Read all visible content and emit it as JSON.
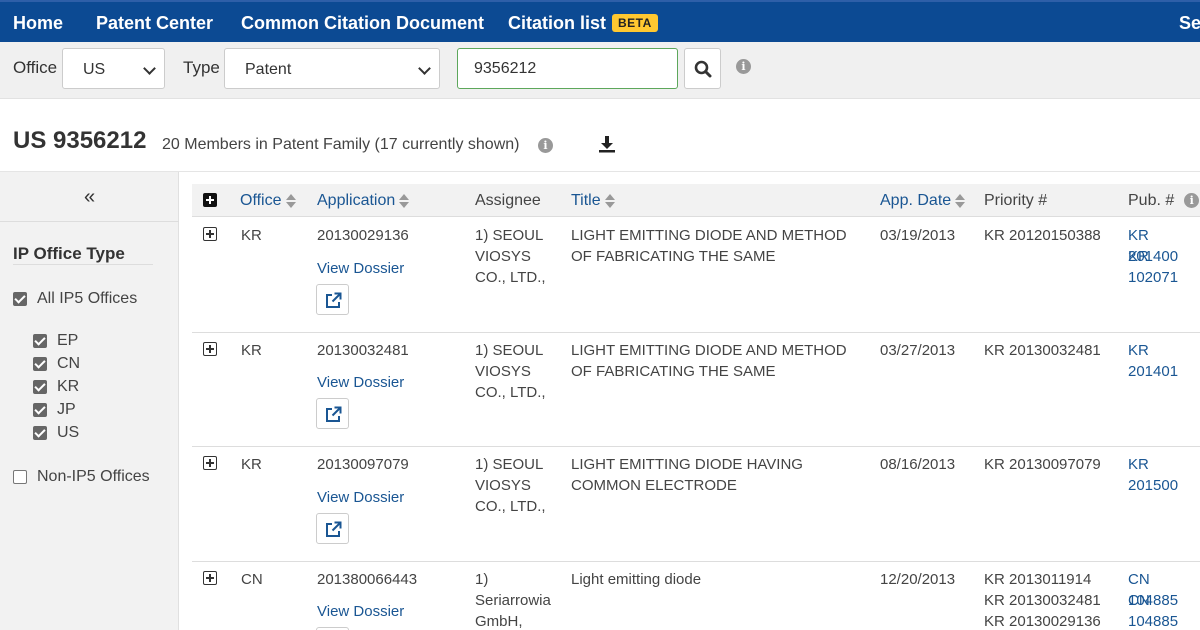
{
  "nav": {
    "items": [
      "Home",
      "Patent Center",
      "Common Citation Document",
      "Citation list"
    ],
    "beta": "BETA",
    "truncated_right": "Se"
  },
  "search": {
    "office_label": "Office",
    "office_value": "US",
    "type_label": "Type",
    "type_value": "Patent",
    "query_value": "9356212"
  },
  "family": {
    "title": "US 9356212",
    "members": "20 Members in Patent Family (17 currently shown)"
  },
  "sidebar": {
    "collapse": "«",
    "heading": "IP Office Type",
    "all_ip5": {
      "label": "All IP5 Offices",
      "checked": true
    },
    "offices": [
      {
        "label": "EP",
        "checked": true
      },
      {
        "label": "CN",
        "checked": true
      },
      {
        "label": "KR",
        "checked": true
      },
      {
        "label": "JP",
        "checked": true
      },
      {
        "label": "US",
        "checked": true
      }
    ],
    "non_ip5": {
      "label": "Non-IP5 Offices",
      "checked": false
    }
  },
  "table": {
    "headers": {
      "office": "Office",
      "application": "Application",
      "assignee": "Assignee",
      "title": "Title",
      "app_date": "App. Date",
      "priority": "Priority #",
      "pub": "Pub. #"
    },
    "view_dossier": "View Dossier",
    "rows": [
      {
        "office": "KR",
        "application": "20130029136",
        "assignee": "1) SEOUL VIOSYS CO., LTD.,",
        "title": "LIGHT EMITTING DIODE AND METHOD OF FABRICATING THE SAME",
        "app_date": "03/19/2013",
        "priority": [
          "KR 20120150388"
        ],
        "pub": [
          "KR 201400",
          "KR 102071"
        ]
      },
      {
        "office": "KR",
        "application": "20130032481",
        "assignee": "1) SEOUL VIOSYS CO., LTD.,",
        "title": "LIGHT EMITTING DIODE AND METHOD OF FABRICATING THE SAME",
        "app_date": "03/27/2013",
        "priority": [
          "KR 20130032481"
        ],
        "pub": [
          "KR 201401"
        ]
      },
      {
        "office": "KR",
        "application": "20130097079",
        "assignee": "1) SEOUL VIOSYS CO., LTD.,",
        "title": "LIGHT EMITTING DIODE HAVING COMMON ELECTRODE",
        "app_date": "08/16/2013",
        "priority": [
          "KR 20130097079"
        ],
        "pub": [
          "KR 201500"
        ]
      },
      {
        "office": "CN",
        "application": "201380066443",
        "assignee": "1) Seriarrowia GmbH,",
        "title": "Light emitting diode",
        "app_date": "12/20/2013",
        "priority": [
          "KR 2013011914",
          "KR 20130032481",
          "KR 20130029136"
        ],
        "pub": [
          "CN 104885",
          "CN 104885"
        ]
      }
    ]
  },
  "colors": {
    "nav_bg": "#0c4a93",
    "link": "#1a5693",
    "beta_badge": "#ffc830",
    "search_border": "#5da75b"
  },
  "icons": [
    "search-icon",
    "info-icon",
    "download-icon",
    "collapse-icon",
    "expand-all-icon",
    "expand-row-icon",
    "external-link-icon",
    "sort-icon",
    "chevron-down-icon"
  ]
}
